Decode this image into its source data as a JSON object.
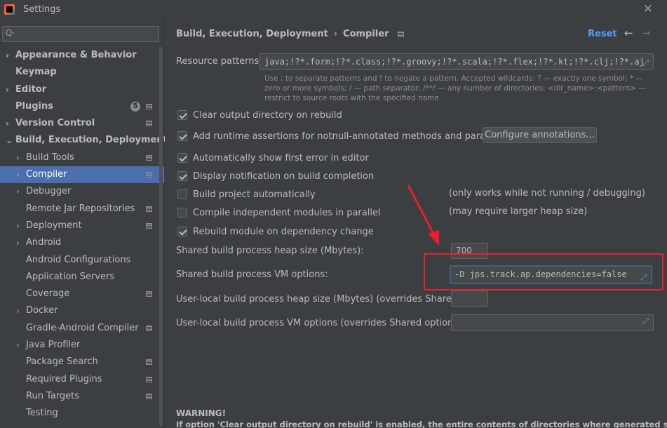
{
  "window": {
    "title": "Settings",
    "close_glyph": "✕"
  },
  "search": {
    "icon": "search-icon",
    "value": ""
  },
  "sidebar": {
    "items": [
      {
        "label": "Appearance & Behavior",
        "arrow": "›",
        "level": 0,
        "bold": true
      },
      {
        "label": "Keymap",
        "arrow": "",
        "level": 0,
        "bold": true
      },
      {
        "label": "Editor",
        "arrow": "›",
        "level": 0,
        "bold": true
      },
      {
        "label": "Plugins",
        "arrow": "",
        "level": 0,
        "bold": true,
        "badge": "5",
        "config": true
      },
      {
        "label": "Version Control",
        "arrow": "›",
        "level": 0,
        "bold": true,
        "config": true
      },
      {
        "label": "Build, Execution, Deployment",
        "arrow": "⌄",
        "level": 0,
        "bold": true
      },
      {
        "label": "Build Tools",
        "arrow": "›",
        "level": 1,
        "config": true
      },
      {
        "label": "Compiler",
        "arrow": "›",
        "level": 1,
        "config": true,
        "selected": true
      },
      {
        "label": "Debugger",
        "arrow": "›",
        "level": 1
      },
      {
        "label": "Remote Jar Repositories",
        "arrow": "",
        "level": 1,
        "config": true
      },
      {
        "label": "Deployment",
        "arrow": "›",
        "level": 1,
        "config": true
      },
      {
        "label": "Android",
        "arrow": "›",
        "level": 1
      },
      {
        "label": "Android Configurations",
        "arrow": "",
        "level": 1
      },
      {
        "label": "Application Servers",
        "arrow": "",
        "level": 1
      },
      {
        "label": "Coverage",
        "arrow": "",
        "level": 1,
        "config": true
      },
      {
        "label": "Docker",
        "arrow": "›",
        "level": 1
      },
      {
        "label": "Gradle-Android Compiler",
        "arrow": "",
        "level": 1,
        "config": true
      },
      {
        "label": "Java Profiler",
        "arrow": "›",
        "level": 1
      },
      {
        "label": "Package Search",
        "arrow": "",
        "level": 1,
        "config": true
      },
      {
        "label": "Required Plugins",
        "arrow": "",
        "level": 1,
        "config": true
      },
      {
        "label": "Run Targets",
        "arrow": "",
        "level": 1,
        "config": true
      },
      {
        "label": "Testing",
        "arrow": "",
        "level": 1
      }
    ]
  },
  "header": {
    "breadcrumb_parent": "Build, Execution, Deployment",
    "breadcrumb_sep": "›",
    "breadcrumb_current": "Compiler",
    "reset": "Reset",
    "back": "←",
    "forward": "→"
  },
  "resource_patterns": {
    "label": "Resource patterns:",
    "value": "java;!?*.form;!?*.class;!?*.groovy;!?*.scala;!?*.flex;!?*.kt;!?*.clj;!?*.aj",
    "hint": "Use ; to separate patterns and ! to negate a pattern. Accepted wildcards: ? — exactly one symbol; * — zero or more symbols; / — path separator; /**/ — any number of directories; <dir_name>:<pattern> — restrict to source roots with the specified name"
  },
  "options": [
    {
      "label": "Clear output directory on rebuild",
      "checked": true
    },
    {
      "label": "Add runtime assertions for notnull-annotated methods and parameters",
      "checked": true
    },
    {
      "label": "Automatically show first error in editor",
      "checked": true
    },
    {
      "label": "Display notification on build completion",
      "checked": true
    },
    {
      "label": "Build project automatically",
      "checked": false,
      "note": "(only works while not running / debugging)"
    },
    {
      "label": "Compile independent modules in parallel",
      "checked": false,
      "note": "(may require larger heap size)"
    },
    {
      "label": "Rebuild module on dependency change",
      "checked": true
    }
  ],
  "configure_button": "Configure annotations...",
  "heap_size": {
    "label": "Shared build process heap size (Mbytes):",
    "value": "700"
  },
  "vm_options": {
    "label": "Shared build process VM options:",
    "value": "-D jps.track.ap.dependencies=false"
  },
  "user_heap": {
    "label": "User-local build process heap size (Mbytes) (overrides Shared size):",
    "value": ""
  },
  "user_vm": {
    "label": "User-local build process VM options (overrides Shared options):",
    "value": ""
  },
  "warning": {
    "title": "WARNING!",
    "text": "If option 'Clear output directory on rebuild' is enabled, the entire contents of directories where generated sources"
  },
  "colors": {
    "accent": "#4b6eaf",
    "link": "#589df6",
    "annotation": "#e8202a",
    "background": "#3c3f41"
  }
}
